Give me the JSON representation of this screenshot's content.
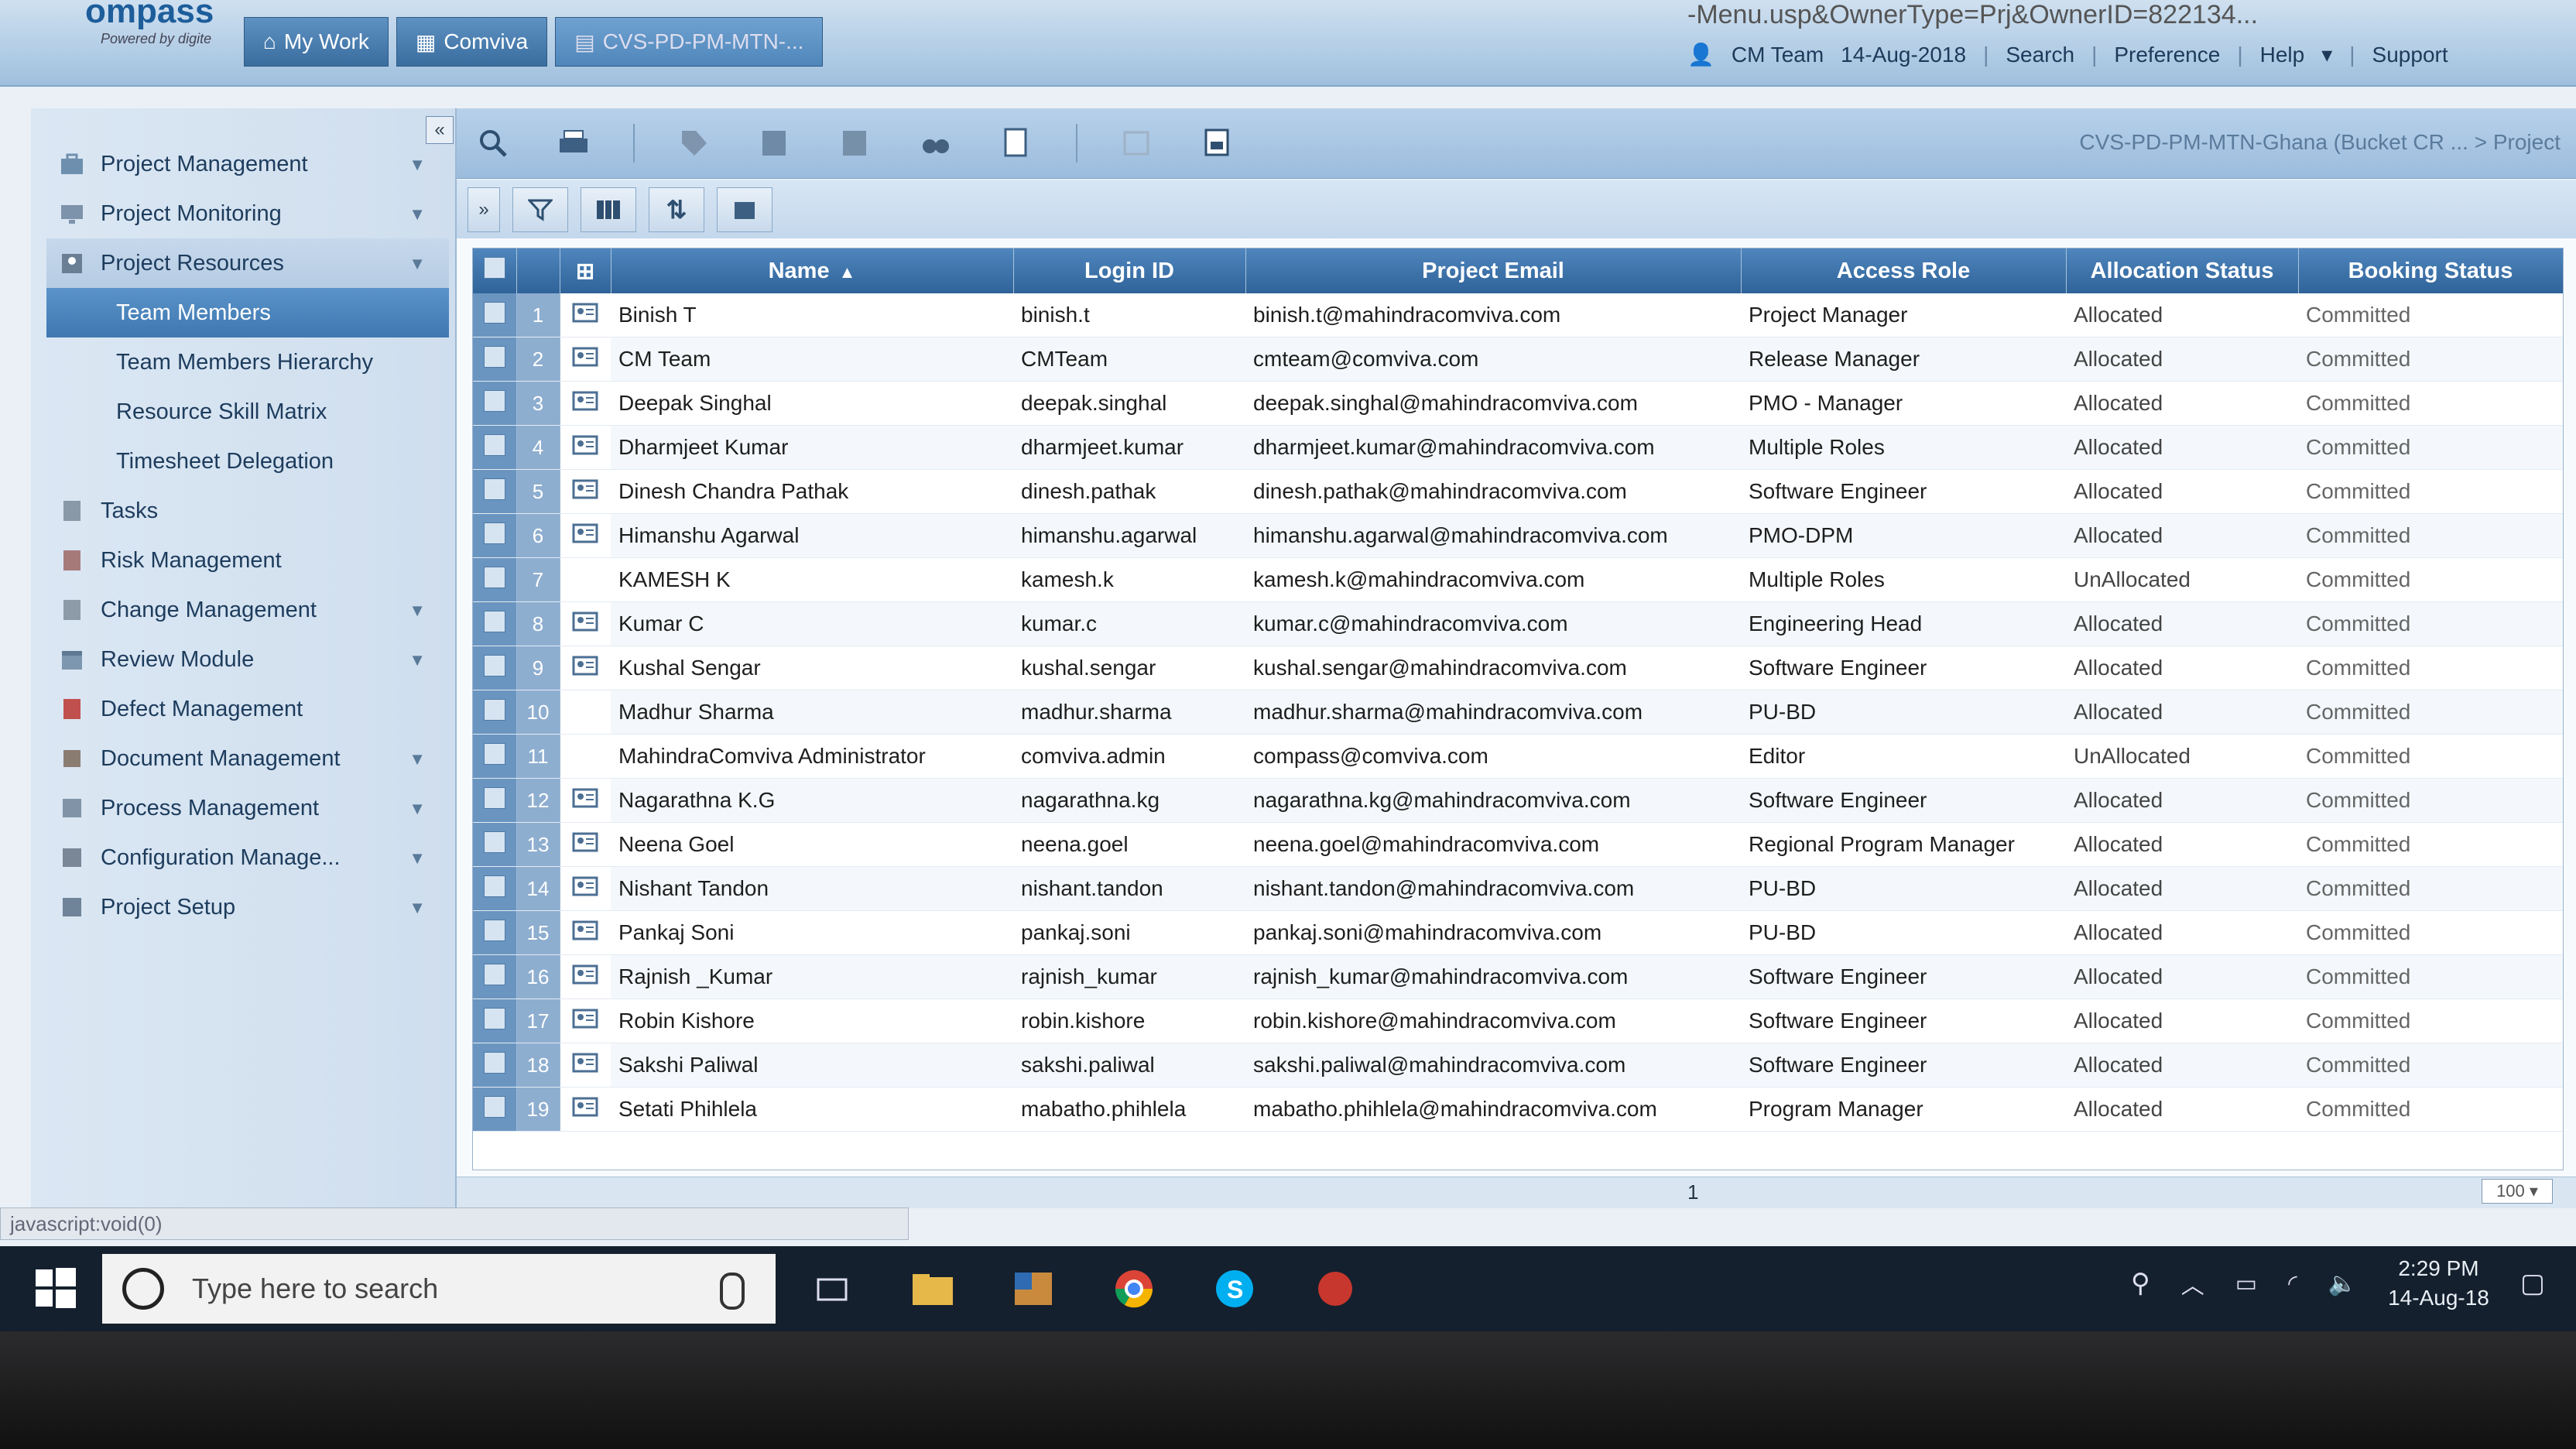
{
  "browser": {
    "url_fragment": "-Menu.usp&OwnerType=Prj&OwnerID=822134..."
  },
  "app": {
    "logo_text": "ompass",
    "logo_sub": "Powered by digite",
    "tabs": [
      {
        "label": "My Work"
      },
      {
        "label": "Comviva"
      },
      {
        "label": "CVS-PD-PM-MTN-..."
      }
    ],
    "header": {
      "user": "CM Team",
      "date": "14-Aug-2018",
      "links": [
        "Search",
        "Preference",
        "Help",
        "Support"
      ]
    }
  },
  "sidebar": {
    "collapse_label": "«",
    "items": [
      {
        "label": "Project Management",
        "icon": "briefcase-icon",
        "caret": true
      },
      {
        "label": "Project Monitoring",
        "icon": "monitor-icon",
        "caret": true
      },
      {
        "label": "Project Resources",
        "icon": "people-icon",
        "caret": true,
        "open": true,
        "children": [
          "Team Members",
          "Team Members Hierarchy",
          "Resource Skill Matrix",
          "Timesheet Delegation"
        ]
      },
      {
        "label": "Tasks",
        "icon": "task-icon",
        "caret": false
      },
      {
        "label": "Risk Management",
        "icon": "risk-icon",
        "caret": false
      },
      {
        "label": "Change Management",
        "icon": "change-icon",
        "caret": true
      },
      {
        "label": "Review Module",
        "icon": "calendar-icon",
        "caret": true
      },
      {
        "label": "Defect Management",
        "icon": "bug-icon",
        "caret": false
      },
      {
        "label": "Document Management",
        "icon": "document-icon",
        "caret": true
      },
      {
        "label": "Process Management",
        "icon": "process-icon",
        "caret": true
      },
      {
        "label": "Configuration Manage...",
        "icon": "configuration-icon",
        "caret": true
      },
      {
        "label": "Project Setup",
        "icon": "setup-icon",
        "caret": true
      }
    ]
  },
  "breadcrumb": "CVS-PD-PM-MTN-Ghana (Bucket CR ... > Project",
  "grid": {
    "columns": [
      "Name",
      "Login ID",
      "Project Email",
      "Access Role",
      "Allocation Status",
      "Booking Status"
    ],
    "rows": [
      {
        "n": "1",
        "name": "Binish T",
        "login": "binish.t",
        "email": "binish.t@mahindracomviva.com",
        "role": "Project Manager",
        "alloc": "Allocated",
        "book": "Committed",
        "icon": true
      },
      {
        "n": "2",
        "name": "CM Team",
        "login": "CMTeam",
        "email": "cmteam@comviva.com",
        "role": "Release Manager",
        "alloc": "Allocated",
        "book": "Committed",
        "icon": true
      },
      {
        "n": "3",
        "name": "Deepak Singhal",
        "login": "deepak.singhal",
        "email": "deepak.singhal@mahindracomviva.com",
        "role": "PMO - Manager",
        "alloc": "Allocated",
        "book": "Committed",
        "icon": true
      },
      {
        "n": "4",
        "name": "Dharmjeet Kumar",
        "login": "dharmjeet.kumar",
        "email": "dharmjeet.kumar@mahindracomviva.com",
        "role": "Multiple Roles",
        "alloc": "Allocated",
        "book": "Committed",
        "icon": true
      },
      {
        "n": "5",
        "name": "Dinesh Chandra Pathak",
        "login": "dinesh.pathak",
        "email": "dinesh.pathak@mahindracomviva.com",
        "role": "Software Engineer",
        "alloc": "Allocated",
        "book": "Committed",
        "icon": true
      },
      {
        "n": "6",
        "name": "Himanshu Agarwal",
        "login": "himanshu.agarwal",
        "email": "himanshu.agarwal@mahindracomviva.com",
        "role": "PMO-DPM",
        "alloc": "Allocated",
        "book": "Committed",
        "icon": true
      },
      {
        "n": "7",
        "name": "KAMESH K",
        "login": "kamesh.k",
        "email": "kamesh.k@mahindracomviva.com",
        "role": "Multiple Roles",
        "alloc": "UnAllocated",
        "book": "Committed",
        "icon": false
      },
      {
        "n": "8",
        "name": "Kumar C",
        "login": "kumar.c",
        "email": "kumar.c@mahindracomviva.com",
        "role": "Engineering Head",
        "alloc": "Allocated",
        "book": "Committed",
        "icon": true
      },
      {
        "n": "9",
        "name": "Kushal Sengar",
        "login": "kushal.sengar",
        "email": "kushal.sengar@mahindracomviva.com",
        "role": "Software Engineer",
        "alloc": "Allocated",
        "book": "Committed",
        "icon": true
      },
      {
        "n": "10",
        "name": "Madhur Sharma",
        "login": "madhur.sharma",
        "email": "madhur.sharma@mahindracomviva.com",
        "role": "PU-BD",
        "alloc": "Allocated",
        "book": "Committed",
        "icon": false
      },
      {
        "n": "11",
        "name": "MahindraComviva Administrator",
        "login": "comviva.admin",
        "email": "compass@comviva.com",
        "role": "Editor",
        "alloc": "UnAllocated",
        "book": "Committed",
        "icon": false
      },
      {
        "n": "12",
        "name": "Nagarathna K.G",
        "login": "nagarathna.kg",
        "email": "nagarathna.kg@mahindracomviva.com",
        "role": "Software Engineer",
        "alloc": "Allocated",
        "book": "Committed",
        "icon": true
      },
      {
        "n": "13",
        "name": "Neena Goel",
        "login": "neena.goel",
        "email": "neena.goel@mahindracomviva.com",
        "role": "Regional Program Manager",
        "alloc": "Allocated",
        "book": "Committed",
        "icon": true
      },
      {
        "n": "14",
        "name": "Nishant Tandon",
        "login": "nishant.tandon",
        "email": "nishant.tandon@mahindracomviva.com",
        "role": "PU-BD",
        "alloc": "Allocated",
        "book": "Committed",
        "icon": true
      },
      {
        "n": "15",
        "name": "Pankaj Soni",
        "login": "pankaj.soni",
        "email": "pankaj.soni@mahindracomviva.com",
        "role": "PU-BD",
        "alloc": "Allocated",
        "book": "Committed",
        "icon": true
      },
      {
        "n": "16",
        "name": "Rajnish _Kumar",
        "login": "rajnish_kumar",
        "email": "rajnish_kumar@mahindracomviva.com",
        "role": "Software Engineer",
        "alloc": "Allocated",
        "book": "Committed",
        "icon": true
      },
      {
        "n": "17",
        "name": "Robin Kishore",
        "login": "robin.kishore",
        "email": "robin.kishore@mahindracomviva.com",
        "role": "Software Engineer",
        "alloc": "Allocated",
        "book": "Committed",
        "icon": true
      },
      {
        "n": "18",
        "name": "Sakshi Paliwal",
        "login": "sakshi.paliwal",
        "email": "sakshi.paliwal@mahindracomviva.com",
        "role": "Software Engineer",
        "alloc": "Allocated",
        "book": "Committed",
        "icon": true
      },
      {
        "n": "19",
        "name": "Setati Phihlela",
        "login": "mabatho.phihlela",
        "email": "mabatho.phihlela@mahindracomviva.com",
        "role": "Program Manager",
        "alloc": "Allocated",
        "book": "Committed",
        "icon": true
      }
    ]
  },
  "footer": {
    "page": "1",
    "zoom": "100"
  },
  "statusbar": "javascript:void(0)",
  "taskbar": {
    "search_placeholder": "Type here to search",
    "time": "2:29 PM",
    "date": "14-Aug-18"
  },
  "colors": {
    "header_blue": "#2f6399",
    "sidebar_active": "#4f86ba"
  }
}
